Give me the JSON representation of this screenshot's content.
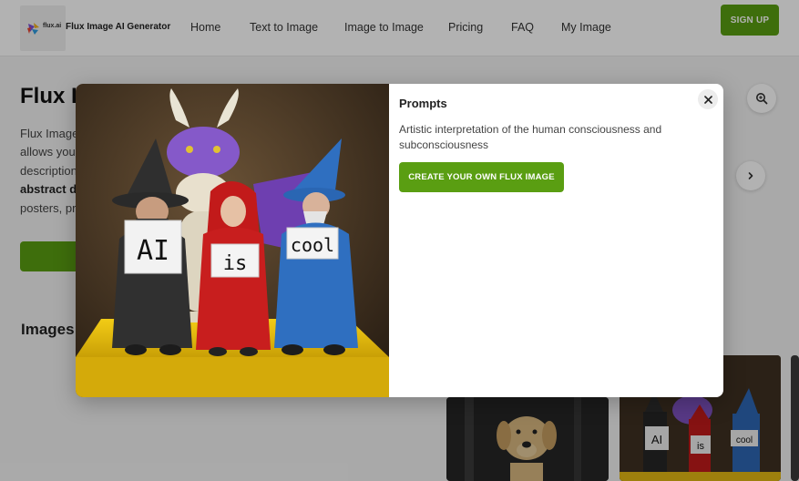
{
  "header": {
    "logo_text": "flux.ai",
    "brand": "Flux Image AI Generator",
    "nav": [
      {
        "label": "Home"
      },
      {
        "label": "Text to Image"
      },
      {
        "label": "Image to Image"
      },
      {
        "label": "Pricing"
      },
      {
        "label": "FAQ"
      },
      {
        "label": "My Image"
      }
    ],
    "signup_label": "SIGN UP"
  },
  "hero": {
    "title_visible": "Flux I",
    "lines": [
      "Flux Image",
      "allows you",
      "description",
      "abstract d",
      "posters, pr"
    ]
  },
  "section": {
    "title_visible": "Images"
  },
  "modal": {
    "heading": "Prompts",
    "prompt": "Artistic interpretation of the human consciousness and subconsciousness",
    "cta_label": "CREATE YOUR OWN FLUX IMAGE",
    "signs": [
      "AI",
      "is",
      "cool"
    ]
  },
  "icons": {
    "close": "close-icon",
    "search": "search-zoom-icon",
    "next": "chevron-right-icon"
  },
  "colors": {
    "accent": "#5a9e12",
    "overlay": "rgba(0,0,0,0.30)"
  }
}
